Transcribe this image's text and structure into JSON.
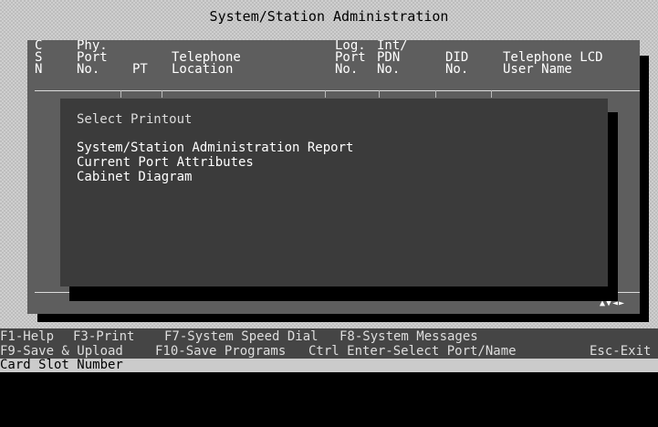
{
  "window": {
    "title": "System/Station Administration"
  },
  "table": {
    "columns": [
      {
        "label": "C\nS\nN"
      },
      {
        "label": "Phy.\nPort\nNo."
      },
      {
        "label": "\n\nPT"
      },
      {
        "label": "\nTelephone\nLocation"
      },
      {
        "label": "Log.\nPort\nNo."
      },
      {
        "label": "Int/\nPDN\nNo."
      },
      {
        "label": "\nDID\nNo."
      },
      {
        "label": "\nTelephone LCD\nUser Name"
      }
    ],
    "scroll_indicator": "▲▼◄►"
  },
  "dialog": {
    "title": "Select Printout",
    "items": [
      {
        "label": "System/Station Administration Report"
      },
      {
        "label": "Current Port Attributes"
      },
      {
        "label": "Cabinet Diagram"
      }
    ]
  },
  "function_keys": {
    "row1": [
      {
        "label": "F1-Help"
      },
      {
        "label": "F3-Print"
      },
      {
        "label": "F7-System Speed Dial"
      },
      {
        "label": "F8-System Messages"
      }
    ],
    "row2": [
      {
        "label": "F9-Save & Upload"
      },
      {
        "label": "F10-Save Programs"
      },
      {
        "label": "Ctrl Enter-Select Port/Name"
      },
      {
        "label": "Esc-Exit"
      }
    ]
  },
  "status_bar": {
    "text": "Card Slot Number"
  }
}
